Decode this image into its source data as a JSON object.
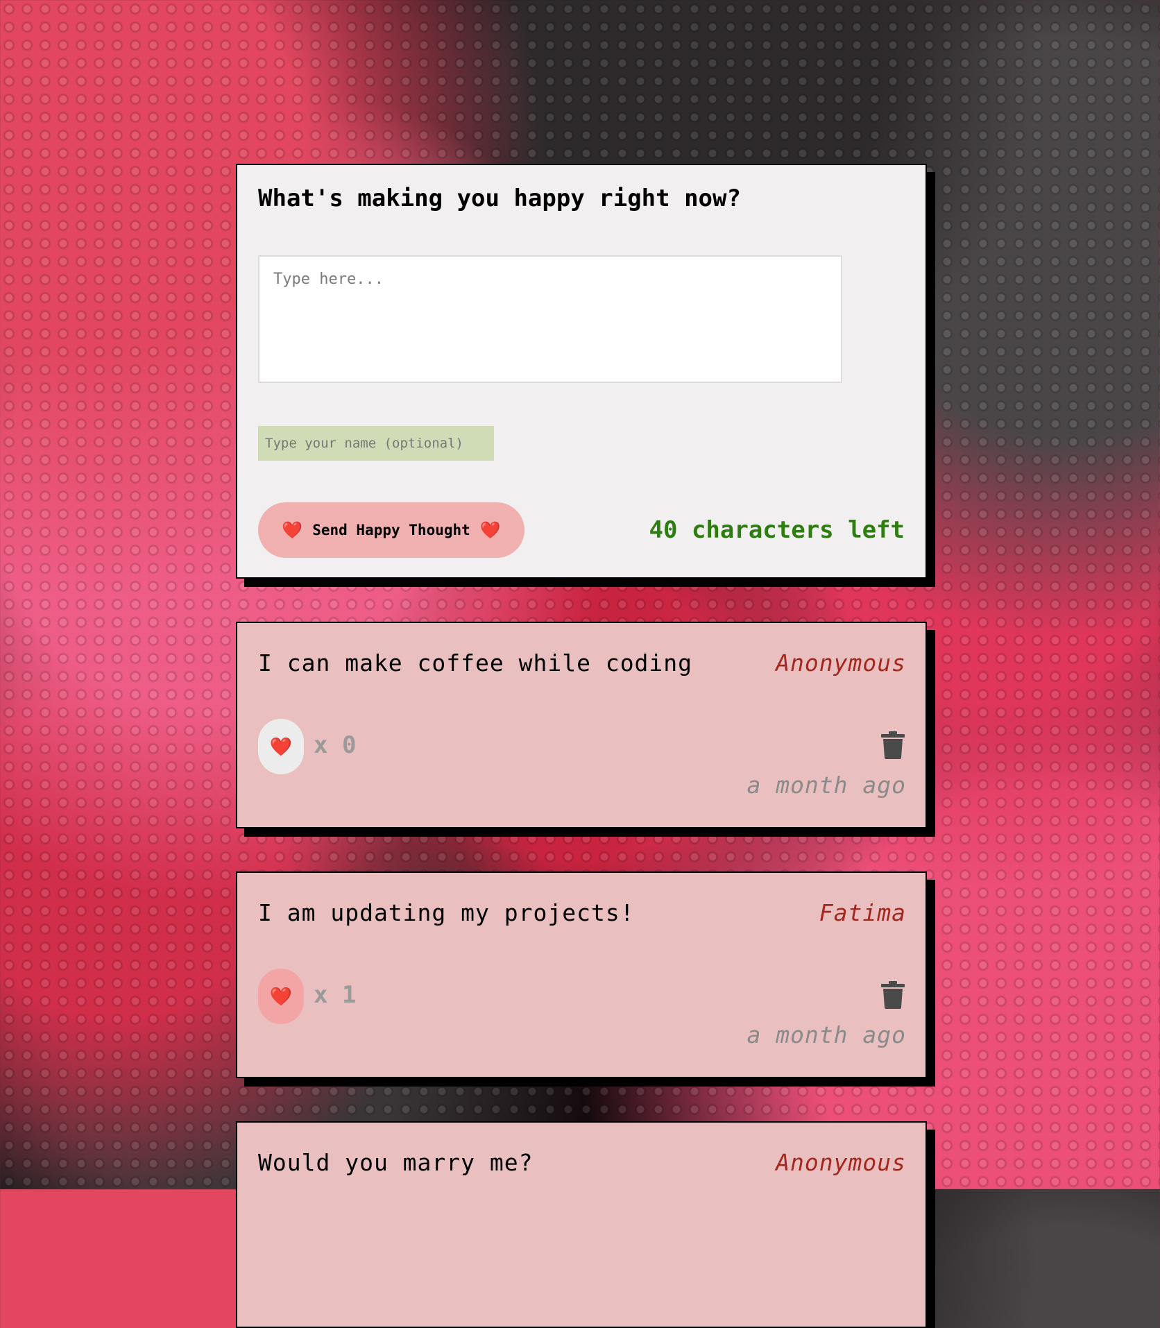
{
  "form": {
    "title": "What's making you happy right now?",
    "message_placeholder": "Type here...",
    "name_placeholder": "Type your name (optional)",
    "send_label": "Send Happy Thought",
    "heart": "❤️",
    "chars_left": "40 characters left"
  },
  "thoughts": [
    {
      "message": "I can make coffee while coding",
      "author": "Anonymous",
      "like_label": "x 0",
      "time": "a month ago"
    },
    {
      "message": "I am updating my projects!",
      "author": "Fatima",
      "like_label": "x 1",
      "time": "a month ago"
    },
    {
      "message": "Would you marry me?",
      "author": "Anonymous"
    }
  ],
  "colors": {
    "accent_green": "#2e7d10",
    "author_red": "#a3271e",
    "card_pink": "#e9bfc0",
    "button_pink": "#f0b0b0"
  },
  "icons": {
    "like": "heart-icon",
    "delete": "trash-icon"
  }
}
